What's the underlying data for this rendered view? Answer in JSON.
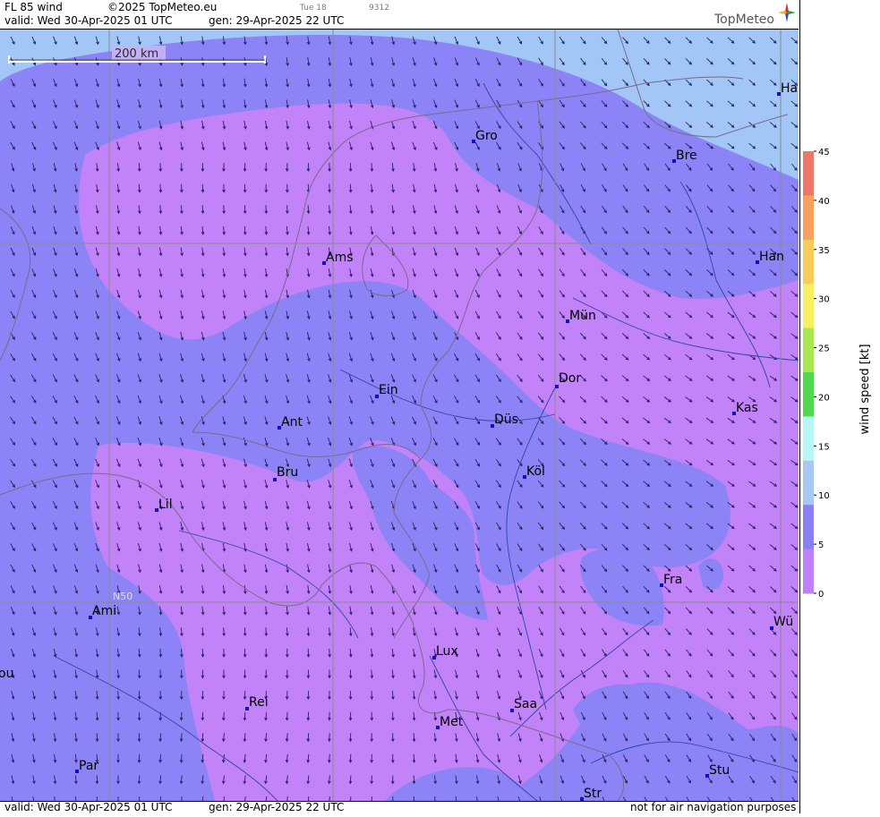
{
  "header": {
    "product": "FL 85 wind",
    "copyright": "©2025 TopMeteo.eu",
    "valid": "valid:  Wed  30-Apr-2025  01 UTC",
    "gen": "gen: 29-Apr-2025 22 UTC",
    "small_left": "Tue 18",
    "small_right": "9312",
    "logo": "TopMeteo"
  },
  "footer": {
    "valid": "valid:  Wed  30-Apr-2025  01 UTC",
    "gen": "gen: 29-Apr-2025 22 UTC",
    "disclaimer": "not for air navigation purposes"
  },
  "map": {
    "scale_label": "200 km",
    "grid_label": "N50",
    "cities": [
      {
        "name": "Gro"
      },
      {
        "name": "Bre"
      },
      {
        "name": "Ha"
      },
      {
        "name": "Ams"
      },
      {
        "name": "Han"
      },
      {
        "name": "Mün"
      },
      {
        "name": "Dor"
      },
      {
        "name": "Ein"
      },
      {
        "name": "Kas"
      },
      {
        "name": "Ant"
      },
      {
        "name": "Düs"
      },
      {
        "name": "Bru"
      },
      {
        "name": "Köl"
      },
      {
        "name": "Lil"
      },
      {
        "name": "Fra"
      },
      {
        "name": "Ami"
      },
      {
        "name": "Wü"
      },
      {
        "name": "Lux"
      },
      {
        "name": "ou"
      },
      {
        "name": "Rei"
      },
      {
        "name": "Saa"
      },
      {
        "name": "Met"
      },
      {
        "name": "Par"
      },
      {
        "name": "Stu"
      },
      {
        "name": "Str"
      }
    ]
  },
  "legend": {
    "title": "wind speed [kt]",
    "ticks": [
      "45",
      "40",
      "35",
      "30",
      "25",
      "20",
      "15",
      "10",
      "5",
      "0"
    ],
    "colors": [
      "#ee7868",
      "#f7a160",
      "#f7cc58",
      "#f7f060",
      "#a8e850",
      "#50d850",
      "#b8f7f7",
      "#a8c8f4",
      "#8a80f4",
      "#c080f8"
    ]
  },
  "colors": {
    "light_blue": "#a2c6f6",
    "blue": "#8c84f6",
    "violet": "#c282f8"
  }
}
